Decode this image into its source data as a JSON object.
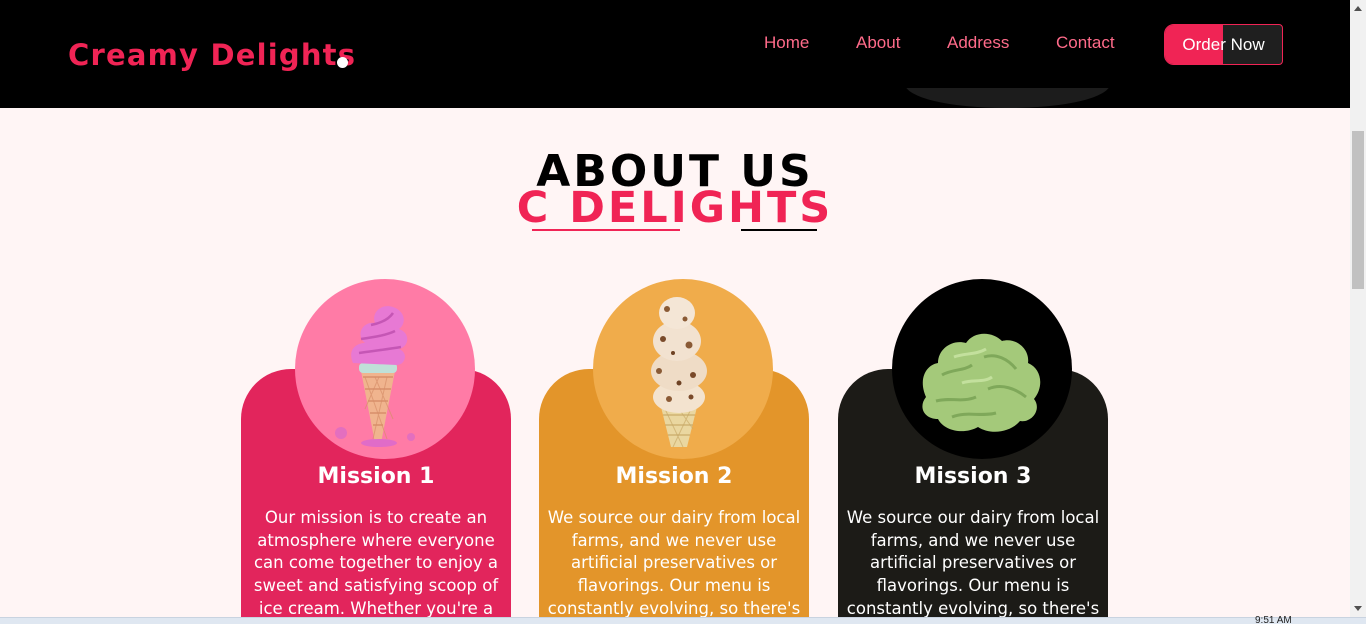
{
  "brand": {
    "logo_text": "Creamy Delights"
  },
  "nav": {
    "items": [
      {
        "label": "Home"
      },
      {
        "label": "About"
      },
      {
        "label": "Address"
      },
      {
        "label": "Contact"
      }
    ],
    "order_button": "Order Now"
  },
  "about": {
    "title": "ABOUT US",
    "subtitle": "C DELIGHTS"
  },
  "cards": [
    {
      "title": "Mission 1",
      "text": "Our mission is to create an atmosphere where everyone can come together to enjoy a sweet and satisfying scoop of ice cream. Whether you're a fan",
      "image": "pink-soft-serve-cone-icon",
      "card_color": "#e2255c",
      "circle_color": "#ff7ba6",
      "text_color": "#ffffff"
    },
    {
      "title": "Mission 2",
      "text": "We source our dairy from local farms, and we never use artificial preservatives or flavorings. Our menu is constantly evolving, so there's",
      "image": "cookie-dough-cone-icon",
      "card_color": "#e3952a",
      "circle_color": "#f0ac4b",
      "text_color": "#ffffff"
    },
    {
      "title": "Mission 3",
      "text": "We source our dairy from local farms, and we never use artificial preservatives or flavorings. Our menu is constantly evolving, so there's",
      "image": "pistachio-scoop-icon",
      "card_color": "#1c1b17",
      "circle_color": "#000000",
      "text_color": "#ffffff"
    }
  ],
  "taskbar": {
    "clock": "9:51 AM"
  }
}
